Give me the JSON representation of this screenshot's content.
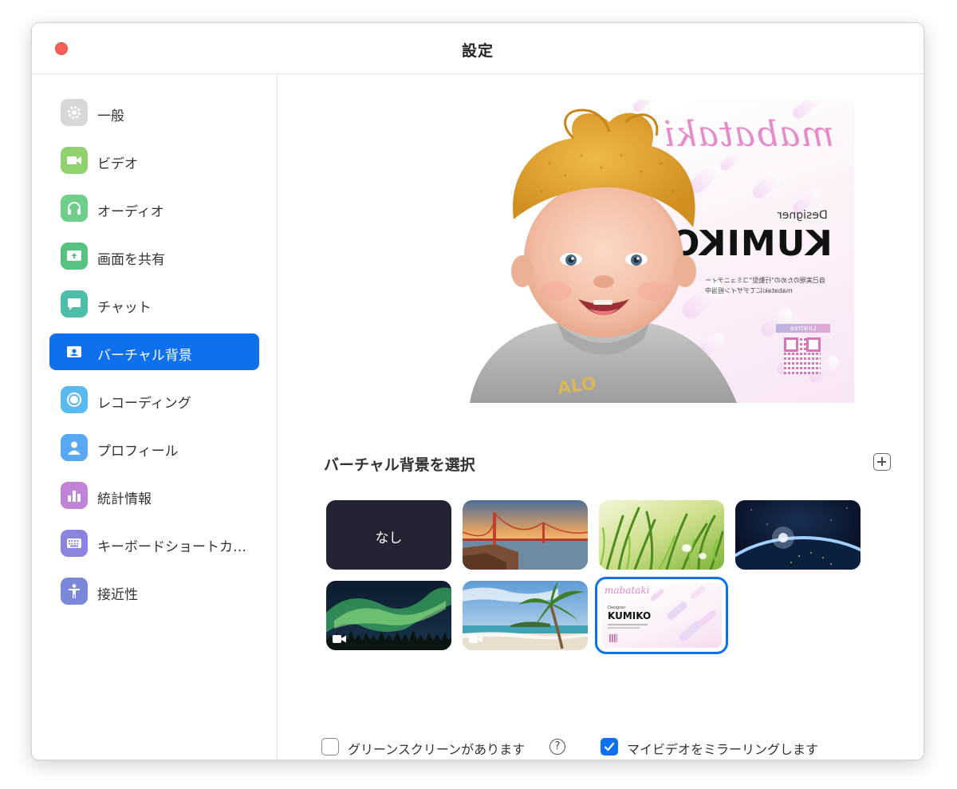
{
  "window": {
    "title": "設定"
  },
  "sidebar": {
    "items": [
      {
        "label": "一般",
        "icon": "gear-icon",
        "color": "#d8d8d8"
      },
      {
        "label": "ビデオ",
        "icon": "video-camera-icon",
        "color": "#8fd26e"
      },
      {
        "label": "オーディオ",
        "icon": "headphones-icon",
        "color": "#6fcf8a"
      },
      {
        "label": "画面を共有",
        "icon": "share-screen-icon",
        "color": "#58c283"
      },
      {
        "label": "チャット",
        "icon": "chat-bubble-icon",
        "color": "#4fbea9"
      },
      {
        "label": "バーチャル背景",
        "icon": "person-card-icon",
        "color": "#0e71eb",
        "active": true
      },
      {
        "label": "レコーディング",
        "icon": "record-icon",
        "color": "#5bb9f2"
      },
      {
        "label": "プロフィール",
        "icon": "user-icon",
        "color": "#5aa8f2"
      },
      {
        "label": "統計情報",
        "icon": "bar-chart-icon",
        "color": "#c083d6"
      },
      {
        "label": "キーボードショートカ…",
        "icon": "keyboard-icon",
        "color": "#8a84dd"
      },
      {
        "label": "接近性",
        "icon": "accessibility-icon",
        "color": "#7b87d8"
      }
    ]
  },
  "preview": {
    "brand": "mabataki",
    "designer_label": "Designer",
    "name": "KUMIKO",
    "tagline_1": "自己実現のための\"行動型\"コミュニティー",
    "tagline_2": "mabatakiにてデザイン担当中",
    "qr_tag": "Linktree"
  },
  "backgrounds": {
    "title": "バーチャル背景を選択",
    "none_label": "なし",
    "items": [
      {
        "name": "none",
        "kind": "none"
      },
      {
        "name": "golden-gate-bridge",
        "kind": "image"
      },
      {
        "name": "grass",
        "kind": "image"
      },
      {
        "name": "earth-from-space",
        "kind": "image"
      },
      {
        "name": "aurora",
        "kind": "video"
      },
      {
        "name": "beach-palm",
        "kind": "video"
      },
      {
        "name": "mabataki-kumiko",
        "kind": "image",
        "selected": true
      }
    ],
    "thumb_kumiko": {
      "brand": "mabataki",
      "designer": "Designer",
      "name": "KUMIKO"
    }
  },
  "options": {
    "green_screen_label": "グリーンスクリーンがあります",
    "green_screen_checked": false,
    "help_glyph": "?",
    "mirror_label": "マイビデオをミラーリングします",
    "mirror_checked": true
  },
  "colors": {
    "accent": "#0e71eb",
    "close": "#fe5f57"
  }
}
